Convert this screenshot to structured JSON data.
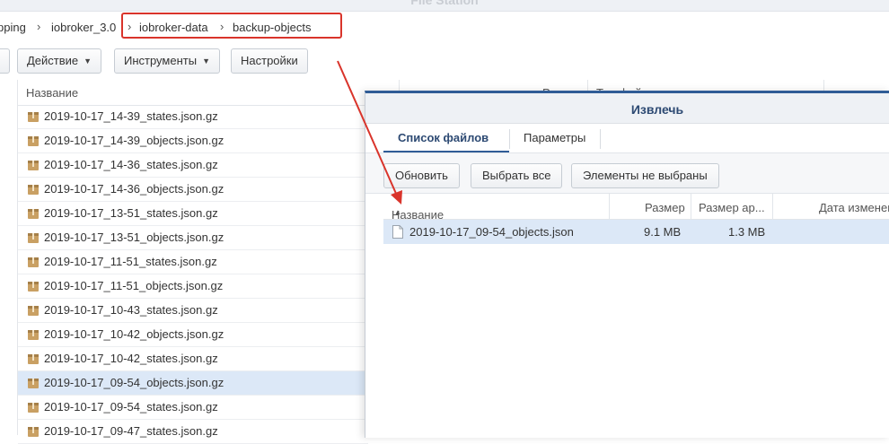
{
  "window": {
    "title": "File Station"
  },
  "breadcrumb": {
    "items": [
      "pping",
      "iobroker_3.0",
      "iobroker-data",
      "backup-objects"
    ]
  },
  "toolbar": {
    "action_label": "Действие",
    "tools_label": "Инструменты",
    "settings_label": "Настройки"
  },
  "file_list": {
    "columns": [
      "Название",
      "Размер",
      "Тип файла"
    ],
    "rows": [
      "2019-10-17_14-39_states.json.gz",
      "2019-10-17_14-39_objects.json.gz",
      "2019-10-17_14-36_states.json.gz",
      "2019-10-17_14-36_objects.json.gz",
      "2019-10-17_13-51_states.json.gz",
      "2019-10-17_13-51_objects.json.gz",
      "2019-10-17_11-51_states.json.gz",
      "2019-10-17_11-51_objects.json.gz",
      "2019-10-17_10-43_states.json.gz",
      "2019-10-17_10-42_objects.json.gz",
      "2019-10-17_10-42_states.json.gz",
      "2019-10-17_09-54_objects.json.gz",
      "2019-10-17_09-54_states.json.gz",
      "2019-10-17_09-47_states.json.gz"
    ],
    "selected_index": 11
  },
  "extract_dialog": {
    "title": "Извлечь",
    "tabs": [
      "Список файлов",
      "Параметры"
    ],
    "active_tab": 0,
    "buttons": {
      "refresh": "Обновить",
      "select_all": "Выбрать все",
      "none_selected": "Элементы не выбраны"
    },
    "columns": {
      "name": "Название",
      "size": "Размер",
      "compressed_size": "Размер ар...",
      "modified_date": "Дата изменен"
    },
    "rows": [
      {
        "name": "2019-10-17_09-54_objects.json",
        "size": "9.1 MB",
        "compressed_size": "1.3 MB",
        "modified_date": ""
      }
    ]
  },
  "colors": {
    "accent": "#2f5c96",
    "annotation": "#d9342b",
    "selection": "#dce8f7",
    "archive_icon": "#c9a063"
  }
}
